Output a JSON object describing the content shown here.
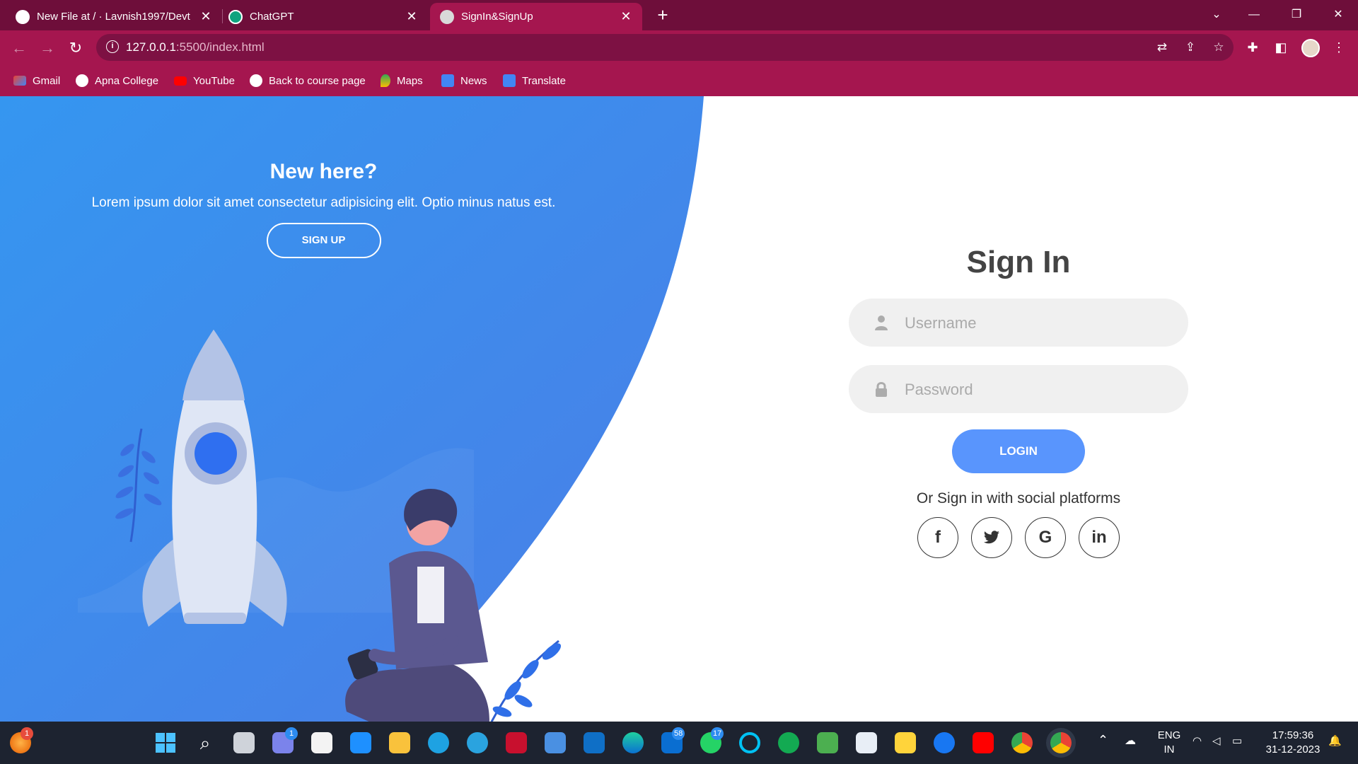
{
  "browser": {
    "tabs": [
      {
        "title": "New File at / · Lavnish1997/Devt",
        "active": false
      },
      {
        "title": "ChatGPT",
        "active": false
      },
      {
        "title": "SignIn&SignUp",
        "active": true
      }
    ],
    "url_host": "127.0.0.1",
    "url_path": ":5500/index.html",
    "bookmarks": [
      "Gmail",
      "Apna College",
      "YouTube",
      "Back to course page",
      "Maps",
      "News",
      "Translate"
    ]
  },
  "left_panel": {
    "heading": "New here?",
    "text": "Lorem ipsum dolor sit amet consectetur adipisicing elit. Optio minus natus est.",
    "signup_label": "SIGN UP"
  },
  "signin_form": {
    "title": "Sign In",
    "username_placeholder": "Username",
    "password_placeholder": "Password",
    "login_label": "LOGIN",
    "social_text": "Or Sign in with social platforms",
    "social_icons": [
      "facebook-icon",
      "twitter-icon",
      "google-icon",
      "linkedin-icon"
    ],
    "social_glyphs": [
      "f",
      "t",
      "G",
      "in"
    ]
  },
  "taskbar": {
    "notification_badge_1": "1",
    "teams_badge": "1",
    "mail_badge": "58",
    "whatsapp_badge": "17",
    "language": "ENG",
    "region": "IN",
    "time": "17:59:36",
    "date": "31-12-2023"
  },
  "colors": {
    "accent": "#a5164f",
    "tabbar": "#6e0e3a",
    "blue": "#4d84e2",
    "login_button": "#5995fd",
    "taskbar": "#1d2330"
  }
}
